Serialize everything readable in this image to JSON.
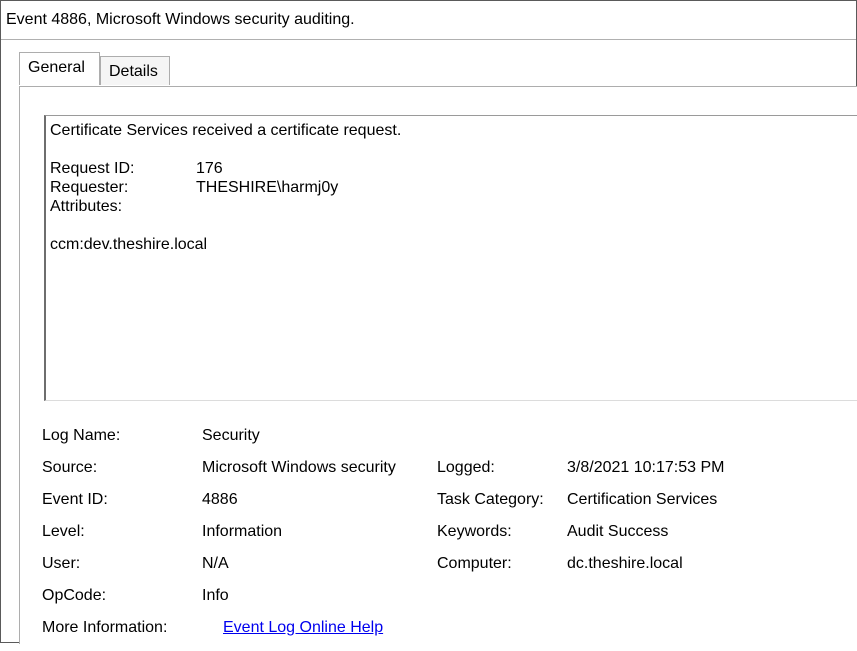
{
  "window": {
    "title": "Event 4886, Microsoft Windows security auditing."
  },
  "tabs": [
    {
      "label": "General",
      "selected": true
    },
    {
      "label": "Details",
      "selected": false
    }
  ],
  "description": {
    "summary": "Certificate Services received a certificate request.",
    "fields": [
      {
        "key": "Request ID:",
        "value": "176"
      },
      {
        "key": "Requester:",
        "value": "THESHIRE\\harmj0y"
      },
      {
        "key": "Attributes:",
        "value": ""
      }
    ],
    "attributes_value": "ccm:dev.theshire.local"
  },
  "info": {
    "log_name": {
      "label": "Log Name:",
      "value": "Security"
    },
    "source": {
      "label": "Source:",
      "value": "Microsoft Windows security"
    },
    "logged": {
      "label": "Logged:",
      "value": "3/8/2021 10:17:53 PM"
    },
    "event_id": {
      "label": "Event ID:",
      "value": "4886"
    },
    "task_category": {
      "label": "Task Category:",
      "value": "Certification Services"
    },
    "level": {
      "label": "Level:",
      "value": "Information"
    },
    "keywords": {
      "label": "Keywords:",
      "value": "Audit Success"
    },
    "user": {
      "label": "User:",
      "value": "N/A"
    },
    "computer": {
      "label": "Computer:",
      "value": "dc.theshire.local"
    },
    "opcode": {
      "label": "OpCode:",
      "value": "Info"
    },
    "more_info": {
      "label": "More Information:",
      "link_text": "Event Log Online Help"
    }
  },
  "colors": {
    "link": "#0000ee",
    "border": "#adadad"
  }
}
